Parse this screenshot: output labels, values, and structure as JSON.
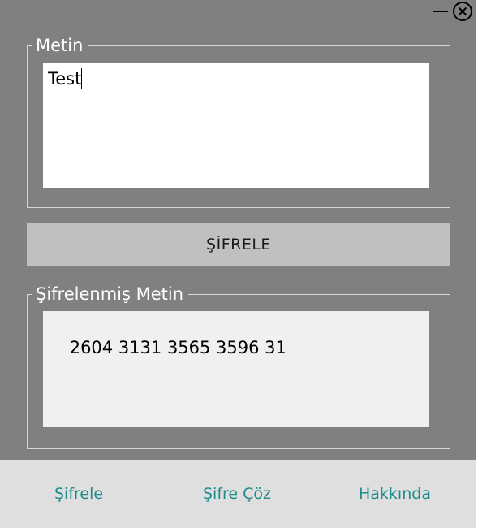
{
  "window": {
    "minimize_icon": "minimize-icon",
    "close_icon": "close-circle-icon"
  },
  "plain_group": {
    "legend": "Metin",
    "value": "Test"
  },
  "encrypt_button": {
    "label": "ŞİFRELE"
  },
  "cipher_group": {
    "legend": "Şifrelenmiş Metin",
    "value": "2604 3131 3565 3596 31"
  },
  "nav": {
    "items": [
      {
        "label": "Şifrele"
      },
      {
        "label": "Şifre Çöz"
      },
      {
        "label": "Hakkında"
      }
    ]
  },
  "colors": {
    "window_bg": "#808080",
    "button_bg": "#c0c0c0",
    "nav_bg": "#dfdfdf",
    "nav_text": "#1e8c8c",
    "output_bg": "#f0f0f0"
  }
}
